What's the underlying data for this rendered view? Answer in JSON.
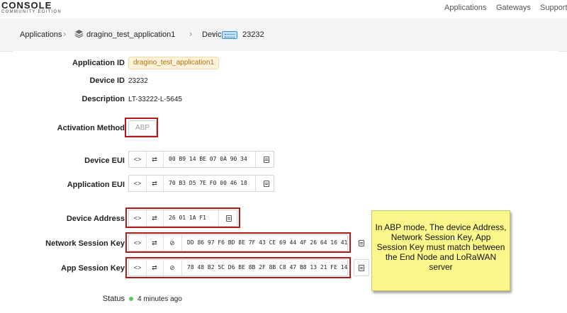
{
  "header": {
    "logo_main": "CONSOLE",
    "logo_sub": "COMMUNITY EDITION",
    "nav": [
      "Applications",
      "Gateways",
      "Support"
    ]
  },
  "breadcrumb": {
    "items": [
      "Applications",
      "dragino_test_application1",
      "Devices",
      "23232"
    ]
  },
  "device": {
    "application_id_label": "Application ID",
    "application_id": "dragino_test_application1",
    "device_id_label": "Device ID",
    "device_id": "23232",
    "description_label": "Description",
    "description": "LT-33222-L-5645",
    "activation_label": "Activation Method",
    "activation": "ABP",
    "dev_eui_label": "Device EUI",
    "dev_eui": "00 B9 14 BE 07 0A 90 34",
    "app_eui_label": "Application EUI",
    "app_eui": "70 B3 D5 7E F0 00 46 18",
    "dev_addr_label": "Device Address",
    "dev_addr": "26 01 1A F1",
    "nwk_skey_label": "Network Session Key",
    "nwk_skey": "DD 86 97 F6 BD 8E 7F 43 CE 69 44 4F 26 64 16 41",
    "app_skey_label": "App Session Key",
    "app_skey": "78 48 B2 5C D6 BE 8B 2F 8B C8 47 B8 13 21 FE 14",
    "status_label": "Status",
    "status": "4 minutes ago"
  },
  "controls": {
    "code_toggle": "<>",
    "byte_order": "⇄",
    "visibility": "⊘"
  },
  "note": {
    "text": "In ABP mode, The device Address, Network Session Key, App Session Key must match between the End Node and LoRaWAN server"
  },
  "colors": {
    "highlight": "#b41a1a",
    "note_bg": "#fbf78a",
    "tag_bg": "#fff3dc",
    "tag_text": "#b36f12",
    "status_dot": "#5cc95c"
  }
}
